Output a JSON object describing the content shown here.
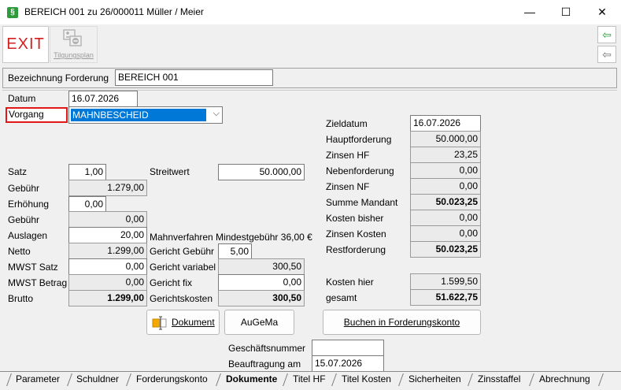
{
  "window": {
    "title": "BEREICH 001 zu 26/000011 Müller / Meier",
    "app_icon": "§",
    "minimize": "—",
    "maximize": "☐",
    "close": "✕"
  },
  "toolbar": {
    "exit_label": "EXIT",
    "tilgungsplan_label": "Tilgungsplan",
    "nav_icon_1": "⇦",
    "nav_icon_2": "⇦"
  },
  "header": {
    "bezeichnung_label": "Bezeichnung Forderung",
    "bezeichnung_value": "BEREICH 001"
  },
  "form": {
    "datum_label": "Datum",
    "datum_value": "16.07.2026",
    "vorgang_label": "Vorgang",
    "vorgang_value": "MAHNBESCHEID",
    "satz_label": "Satz",
    "satz_value": "1,00",
    "streitwert_label": "Streitwert",
    "streitwert_value": "50.000,00",
    "gebuehr_label": "Gebühr",
    "gebuehr_value": "1.279,00",
    "erhoehung_label": "Erhöhung",
    "erhoehung_value": "0,00",
    "gebuehr2_label": "Gebühr",
    "gebuehr2_value": "0,00",
    "auslagen_label": "Auslagen",
    "auslagen_value": "20,00",
    "netto_label": "Netto",
    "netto_value": "1.299,00",
    "mwst_satz_label": "MWST Satz",
    "mwst_satz_value": "0,00",
    "mwst_betrag_label": "MWST Betrag",
    "mwst_betrag_value": "0,00",
    "brutto_label": "Brutto",
    "brutto_value": "1.299,00",
    "mindestgebuehr_label": "Mahnverfahren Mindestgebühr 36,00 €",
    "gericht_gebuehr_label": "Gericht Gebühr",
    "gericht_gebuehr_value": "5,00",
    "gericht_variabel_label": "Gericht variabel",
    "gericht_variabel_value": "300,50",
    "gericht_fix_label": "Gericht fix",
    "gericht_fix_value": "0,00",
    "gerichtskosten_label": "Gerichtskosten",
    "gerichtskosten_value": "300,50"
  },
  "summary": {
    "zieldatum_label": "Zieldatum",
    "zieldatum_value": "16.07.2026",
    "hauptforderung_label": "Hauptforderung",
    "hauptforderung_value": "50.000,00",
    "zinsen_hf_label": "Zinsen HF",
    "zinsen_hf_value": "23,25",
    "nebenforderung_label": "Nebenforderung",
    "nebenforderung_value": "0,00",
    "zinsen_nf_label": "Zinsen NF",
    "zinsen_nf_value": "0,00",
    "summe_mandant_label": "Summe Mandant",
    "summe_mandant_value": "50.023,25",
    "kosten_bisher_label": "Kosten bisher",
    "kosten_bisher_value": "0,00",
    "zinsen_kosten_label": "Zinsen Kosten",
    "zinsen_kosten_value": "0,00",
    "restforderung_label": "Restforderung",
    "restforderung_value": "50.023,25",
    "kosten_hier_label": "Kosten hier",
    "kosten_hier_value": "1.599,50",
    "gesamt_label": "gesamt",
    "gesamt_value": "51.622,75"
  },
  "buttons": {
    "dokument": "Dokument",
    "augema": "AuGeMa",
    "buchen": "Buchen in Forderungskonto"
  },
  "footer_fields": {
    "geschaeftsnummer_label": "Geschäftsnummer",
    "geschaeftsnummer_value": "",
    "beauftragung_label": "Beauftragung am",
    "beauftragung_value": "15.07.2026"
  },
  "tabs": [
    "Parameter",
    "Schuldner",
    "Forderungskonto",
    "Dokumente",
    "Titel HF",
    "Titel Kosten",
    "Sicherheiten",
    "Zinsstaffel",
    "Abrechnung"
  ],
  "active_tab": "Dokumente"
}
